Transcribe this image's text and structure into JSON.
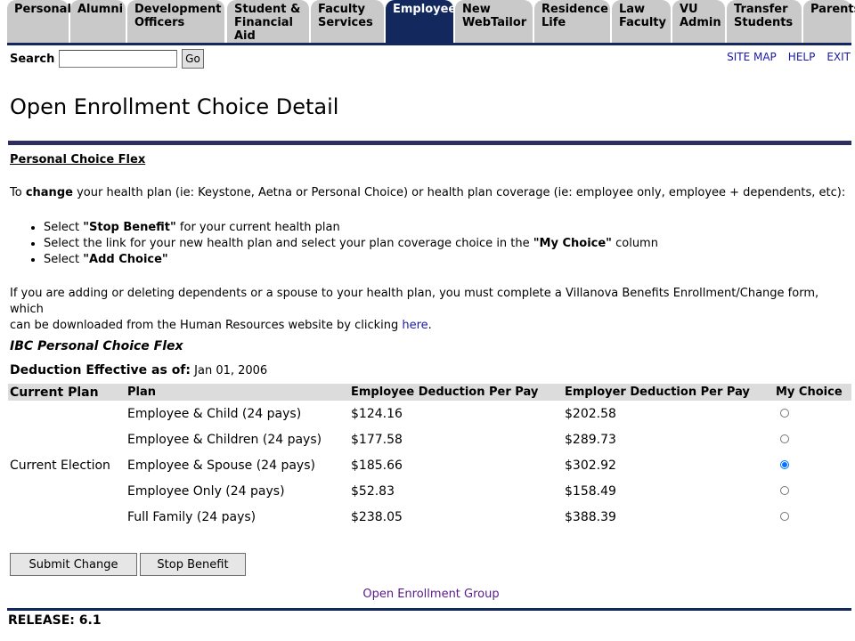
{
  "tabs": [
    {
      "label": "Personal"
    },
    {
      "label": "Alumni"
    },
    {
      "label": "Development Officers"
    },
    {
      "label": "Student & Financial Aid"
    },
    {
      "label": "Faculty Services"
    },
    {
      "label": "Employee"
    },
    {
      "label": "New WebTailor"
    },
    {
      "label": "Residence Life"
    },
    {
      "label": "Law Faculty"
    },
    {
      "label": "VU Admin"
    },
    {
      "label": "Transfer Students"
    },
    {
      "label": "Parents"
    }
  ],
  "search": {
    "label": "Search",
    "value": "",
    "go_label": "Go"
  },
  "toplinks": {
    "site_map": "SITE MAP",
    "help": "HELP",
    "exit": "EXIT"
  },
  "page_title": "Open Enrollment Choice Detail",
  "section_heading": "Personal Choice Flex",
  "intro": {
    "pre": "To ",
    "bold": "change",
    "post": " your health plan (ie: Keystone, Aetna or Personal Choice) or health plan coverage (ie: employee only, employee + dependents, etc):"
  },
  "steps": [
    {
      "pre": "Select ",
      "bold": "\"Stop Benefit\"",
      "post": " for your current health plan"
    },
    {
      "pre": "Select the link for your new health plan and select your plan coverage choice in the ",
      "bold": "\"My Choice\"",
      "post": " column"
    },
    {
      "pre": "Select ",
      "bold": "\"Add Choice\"",
      "post": ""
    }
  ],
  "dependents_note": {
    "line1": "If you are adding or deleting dependents or a spouse to your health plan, you must complete a Villanova Benefits Enrollment/Change form, which",
    "line2": "can be downloaded from the Human Resources website by clicking ",
    "link": "here",
    "end": "."
  },
  "plan_name": "IBC Personal Choice Flex",
  "effective": {
    "label": "Deduction Effective as of:",
    "date": "Jan 01, 2006"
  },
  "table": {
    "headers": [
      "Current Plan",
      "Plan",
      "Employee Deduction Per Pay",
      "Employer Deduction Per Pay",
      "My Choice"
    ],
    "rows": [
      {
        "current": "",
        "plan": "Employee & Child (24 pays)",
        "employee": "$124.16",
        "employer": "$202.58",
        "selected": false
      },
      {
        "current": "",
        "plan": "Employee & Children (24 pays)",
        "employee": "$177.58",
        "employer": "$289.73",
        "selected": false
      },
      {
        "current": "Current Election",
        "plan": "Employee & Spouse (24 pays)",
        "employee": "$185.66",
        "employer": "$302.92",
        "selected": true
      },
      {
        "current": "",
        "plan": "Employee Only (24 pays)",
        "employee": "$52.83",
        "employer": "$158.49",
        "selected": false
      },
      {
        "current": "",
        "plan": "Full Family (24 pays)",
        "employee": "$238.05",
        "employer": "$388.39",
        "selected": false
      }
    ]
  },
  "buttons": {
    "submit": "Submit Change",
    "stop": "Stop Benefit"
  },
  "group_link": "Open Enrollment Group",
  "release": "RELEASE: 6.1",
  "colors": {
    "tab_bg": "#c9c9c9",
    "tab_active": "#13295e",
    "link": "#1a1aa6",
    "visited_link": "#5a1a8a"
  }
}
